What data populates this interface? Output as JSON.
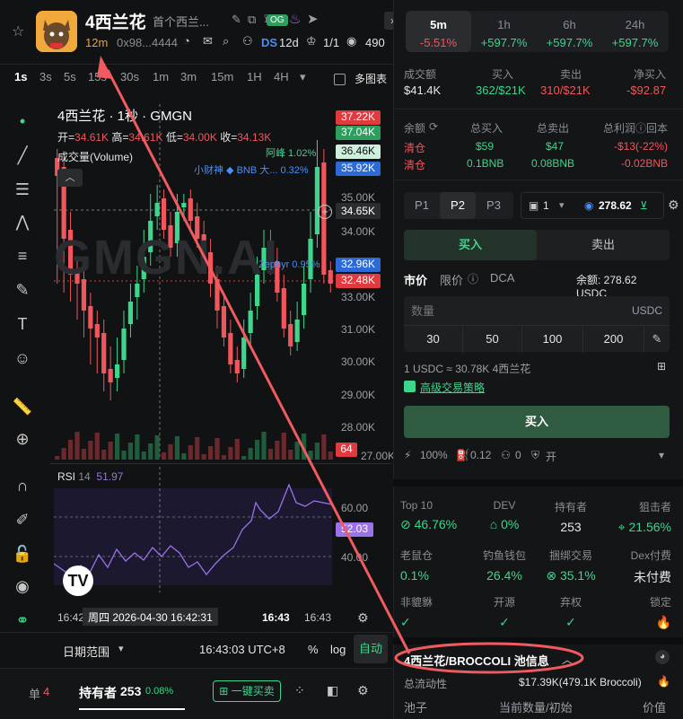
{
  "header": {
    "title": "4西兰花",
    "subtitle": "首个西兰...",
    "age": "12m",
    "address": "0x98...4444",
    "og_badge": "OG",
    "ds_label": "DS",
    "ds_age": "12d",
    "ratio": "1/1",
    "views": "490"
  },
  "timeframes": [
    "1s",
    "3s",
    "5s",
    "15s",
    "30s",
    "1m",
    "3m",
    "15m",
    "1H",
    "4H"
  ],
  "multi_chart_label": "多图表",
  "chart": {
    "title": "4西兰花 · 1秒 · GMGN",
    "ohlc": {
      "open_label": "开=",
      "open": "34.61K",
      "high_label": "高=",
      "high": "34.61K",
      "low_label": "低=",
      "low": "34.00K",
      "close_label": "收=",
      "close": "34.13K"
    },
    "volume_label": "成交量(Volume)",
    "watermark": "GMGN.AI",
    "price_tags": [
      {
        "text": "37.22K",
        "bg": "#e03a3f"
      },
      {
        "text": "37.04K",
        "bg": "#2e9e5e"
      },
      {
        "text": "36.46K",
        "bg": "#cfeede",
        "fg": "#111"
      },
      {
        "text": "35.92K",
        "bg": "#2c6ad8"
      },
      {
        "text": "34.65K",
        "bg": "#2a2c30"
      },
      {
        "text": "32.96K",
        "bg": "#2c6ad8"
      },
      {
        "text": "32.48K",
        "bg": "#e03a3f"
      },
      {
        "text": "64",
        "bg": "#e03a3f"
      }
    ],
    "axis_labels": [
      "35.00K",
      "34.00K",
      "33.00K",
      "31.00K",
      "30.00K",
      "29.00K",
      "28.00K",
      "27.00K"
    ],
    "annotations": [
      {
        "text": "阿峰 1.02%",
        "color": "#3dd68c"
      },
      {
        "text": "小财神 ◆ BNB 大... 0.32%",
        "color": "#4c8df6"
      },
      {
        "text": "Zephyr 0.95%",
        "color": "#4c8df6"
      }
    ],
    "rsi_label": "RSI",
    "rsi_period": "14",
    "rsi_value": "51.97",
    "rsi_levels": [
      "60.00",
      "40.00"
    ],
    "rsi_tag": "52.03",
    "time_ticks": [
      "16:42",
      "16:43",
      "16:43"
    ],
    "crosshair_time": "周四 2026-04-30  16:42:31"
  },
  "chart_footer": {
    "date_range": "日期范围",
    "clock": "16:43:03 UTC+8",
    "pct": "%",
    "log": "log",
    "auto": "自动"
  },
  "bottom_bar": {
    "orders_label": "单",
    "orders_count": "4",
    "holders_label": "持有者",
    "holders_count": "253",
    "holders_pct": "0.08%",
    "quick_buy": "一键买卖"
  },
  "intervals": [
    {
      "label": "5m",
      "pct": "-5.51%",
      "color": "#f0565c"
    },
    {
      "label": "1h",
      "pct": "+597.7%",
      "color": "#3dd68c"
    },
    {
      "label": "6h",
      "pct": "+597.7%",
      "color": "#3dd68c"
    },
    {
      "label": "24h",
      "pct": "+597.7%",
      "color": "#3dd68c"
    }
  ],
  "stats": {
    "volume_label": "成交额",
    "volume": "$41.4K",
    "buy_label": "买入",
    "buy": "362/$21K",
    "sell_label": "卖出",
    "sell": "310/$21K",
    "net_label": "净买入",
    "net": "-$92.87"
  },
  "balance": {
    "balance_label": "余额",
    "total_buy_label": "总买入",
    "total_sell_label": "总卖出",
    "pnl_label": "总利润",
    "return_label": "回本",
    "clear1": "清仓",
    "buy_usd": "$59",
    "sell_usd": "$47",
    "pnl_usd": "-$13(-22%)",
    "clear2": "清仓",
    "buy_bnb": "0.1BNB",
    "sell_bnb": "0.08BNB",
    "pnl_bnb": "-0.02BNB"
  },
  "trade": {
    "presets": [
      "P1",
      "P2",
      "P3"
    ],
    "wallet_count": "1",
    "wallet_balance": "278.62",
    "buy_tab": "买入",
    "sell_tab": "卖出",
    "order_types": [
      "市价",
      "限价",
      "DCA"
    ],
    "balance_text": "余额: 278.62 USDC",
    "amount_placeholder": "数量",
    "amount_unit": "USDC",
    "quick_amounts": [
      "30",
      "50",
      "100",
      "200"
    ],
    "rate": "1 USDC ≈ 30.78K 4西兰花",
    "advanced": "高级交易策略",
    "buy_button": "买入",
    "slippage": "100%",
    "gas": "0.12",
    "tip": "0",
    "mev": "开"
  },
  "token_stats": [
    {
      "label": "Top 10",
      "value": "46.76%",
      "color": "#3dd68c"
    },
    {
      "label": "DEV",
      "value": "0%",
      "color": "#3dd68c"
    },
    {
      "label": "持有者",
      "value": "253",
      "color": "#e6e6e6"
    },
    {
      "label": "狙击者",
      "value": "21.56%",
      "color": "#3dd68c"
    },
    {
      "label": "老鼠仓",
      "value": "0.1%",
      "color": "#3dd68c"
    },
    {
      "label": "钓鱼钱包",
      "value": "26.4%",
      "color": "#3dd68c"
    },
    {
      "label": "捆绑交易",
      "value": "35.1%",
      "color": "#3dd68c"
    },
    {
      "label": "Dex付费",
      "value": "未付费",
      "color": "#e6e6e6"
    },
    {
      "label": "非貔貅",
      "value": "",
      "color": "#3dd68c"
    },
    {
      "label": "开源",
      "value": "",
      "color": "#3dd68c"
    },
    {
      "label": "弃权",
      "value": "",
      "color": "#3dd68c"
    },
    {
      "label": "锁定",
      "value": "",
      "color": "#f29b38"
    }
  ],
  "pool": {
    "title": "4西兰花/BROCCOLI 池信息",
    "liquidity_label": "总流动性",
    "liquidity": "$17.39K(479.1K Broccoli)",
    "pool_label": "池子",
    "current_label": "当前数量/初始",
    "value_label": "价值"
  },
  "colors": {
    "up": "#3dd68c",
    "down": "#f0565c",
    "accent": "#2f5b41",
    "annotation": "#ef5b5f"
  }
}
